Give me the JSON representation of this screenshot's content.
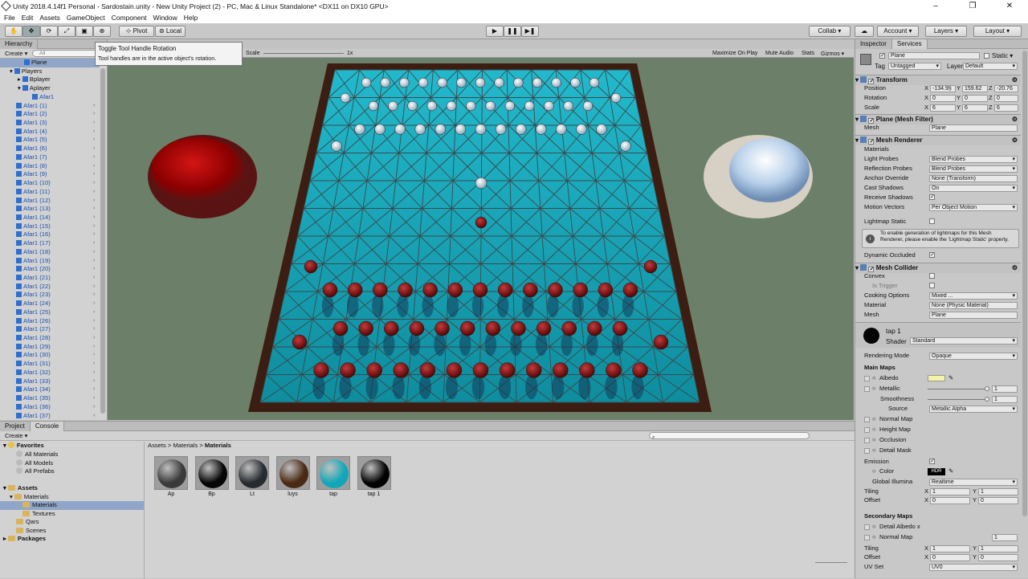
{
  "window": {
    "title": "Unity 2018.4.14f1 Personal - Sardostain.unity - New Unity Project (2) - PC, Mac & Linux Standalone* <DX11 on DX10 GPU>"
  },
  "menu": [
    "File",
    "Edit",
    "Assets",
    "GameObject",
    "Component",
    "Window",
    "Help"
  ],
  "toolbar": {
    "pivot": "Pivot",
    "local": "Local",
    "collab": "Collab ▾",
    "account": "Account",
    "layers": "Layers",
    "layout": "Layout"
  },
  "tooltip": {
    "title": "Toggle Tool Handle Rotation",
    "body": "Tool handles are in the active object's rotation."
  },
  "hierarchy": {
    "tab": "Hierarchy",
    "create": "Create ▾",
    "search": "All",
    "items": [
      "Plane",
      "Players",
      "Bplayer",
      "Aplayer",
      "Afar1",
      "Afar1 (1)",
      "Afar1 (2)",
      "Afar1 (3)",
      "Afar1 (4)",
      "Afar1 (5)",
      "Afar1 (6)",
      "Afar1 (7)",
      "Afar1 (8)",
      "Afar1 (9)",
      "Afar1 (10)",
      "Afar1 (11)",
      "Afar1 (12)",
      "Afar1 (13)",
      "Afar1 (14)",
      "Afar1 (15)",
      "Afar1 (16)",
      "Afar1 (17)",
      "Afar1 (18)",
      "Afar1 (19)",
      "Afar1 (20)",
      "Afar1 (21)",
      "Afar1 (22)",
      "Afar1 (23)",
      "Afar1 (24)",
      "Afar1 (25)",
      "Afar1 (26)",
      "Afar1 (27)",
      "Afar1 (28)",
      "Afar1 (29)",
      "Afar1 (30)",
      "Afar1 (31)",
      "Afar1 (32)",
      "Afar1 (33)",
      "Afar1 (34)",
      "Afar1 (35)",
      "Afar1 (36)",
      "Afar1 (37)"
    ]
  },
  "scene": {
    "scale_label": "Scale",
    "scale_value": "1x",
    "buttons": [
      "Maximize On Play",
      "Mute Audio",
      "Stats",
      "Gizmos ▾"
    ]
  },
  "inspector": {
    "tabs": [
      "Inspector",
      "Services"
    ],
    "object_name": "Plane",
    "static": "Static ▾",
    "tag_label": "Tag",
    "tag": "Untagged",
    "layer_label": "Layer",
    "layer": "Default",
    "transform": {
      "title": "Transform",
      "position": {
        "label": "Position",
        "x": "-134.9§",
        "y": "159.62",
        "z": "-20.76"
      },
      "rotation": {
        "label": "Rotation",
        "x": "0",
        "y": "0",
        "z": "0"
      },
      "scale": {
        "label": "Scale",
        "x": "6",
        "y": "6",
        "z": "6"
      }
    },
    "mesh_filter": {
      "title": "Plane (Mesh Filter)",
      "mesh_label": "Mesh",
      "mesh": "Plane"
    },
    "mesh_renderer": {
      "title": "Mesh Renderer",
      "materials": "Materials",
      "light_probes": "Light Probes",
      "light_probes_v": "Blend Probes",
      "reflection": "Reflection Probes",
      "reflection_v": "Blend Probes",
      "anchor": "Anchor Override",
      "anchor_v": "None (Transform)",
      "cast": "Cast Shadows",
      "cast_v": "On",
      "receive": "Receive Shadows",
      "motion": "Motion Vectors",
      "motion_v": "Per Object Motion",
      "lightmap": "Lightmap Static",
      "info": "To enable generation of lightmaps for this Mesh Renderer, please enable the 'Lightmap Static' property.",
      "dynamic": "Dynamic Occluded"
    },
    "mesh_collider": {
      "title": "Mesh Collider",
      "convex": "Convex",
      "trigger": "Is Trigger",
      "cooking": "Cooking Options",
      "cooking_v": "Mixed ...",
      "material": "Material",
      "material_v": "None (Physic Material)",
      "mesh": "Mesh",
      "mesh_v": "Plane"
    },
    "material": {
      "name": "tap 1",
      "shader_label": "Shader",
      "shader": "Standard",
      "rendering_mode": "Rendering Mode",
      "rendering_v": "Opaque",
      "main_maps": "Main Maps",
      "albedo": "Albedo",
      "metallic": "Metallic",
      "metallic_v": "1",
      "smoothness": "Smoothness",
      "smoothness_v": "1",
      "source": "Source",
      "source_v": "Metallic Alpha",
      "normal": "Normal Map",
      "height": "Height Map",
      "occlusion": "Occlusion",
      "detail": "Detail Mask",
      "emission": "Emission",
      "color": "Color",
      "hdr": "HDR",
      "gi": "Global Illumina",
      "gi_v": "Realtime",
      "tiling": "Tiling",
      "offset": "Offset",
      "tx": "1",
      "ty": "1",
      "ox": "0",
      "oy": "0",
      "secondary": "Secondary Maps",
      "detail_albedo": "Detail Albedo x",
      "normal2": "Normal Map",
      "normal2_v": "1",
      "tiling2": "Tiling",
      "offset2": "Offset",
      "t2x": "1",
      "t2y": "1",
      "o2x": "0",
      "o2y": "0",
      "uv": "UV Set",
      "uv_v": "UV0"
    }
  },
  "project": {
    "tabs": [
      "Project",
      "Console"
    ],
    "create": "Create ▾",
    "favorites": "Favorites",
    "fav_items": [
      "All Materials",
      "All Models",
      "All Prefabs"
    ],
    "assets": "Assets",
    "asset_tree": [
      "Materials",
      "Materials",
      "Textures",
      "Qars",
      "Scenes"
    ],
    "packages": "Packages",
    "breadcrumb": [
      "Assets",
      "Materials",
      "Materials"
    ],
    "materials": [
      {
        "name": "Ap",
        "color": "#3a3a3a"
      },
      {
        "name": "Bp",
        "color": "#050505"
      },
      {
        "name": "Lt",
        "color": "#262b30"
      },
      {
        "name": "luys",
        "color": "#4a2a14"
      },
      {
        "name": "tap",
        "color": "#11a7b8"
      },
      {
        "name": "tap 1",
        "color": "#020202"
      }
    ]
  },
  "colors": {
    "board": "#1ba9bd",
    "frame": "#3b1d12",
    "red": "#8a0b0b",
    "white": "#dbe6ee"
  }
}
